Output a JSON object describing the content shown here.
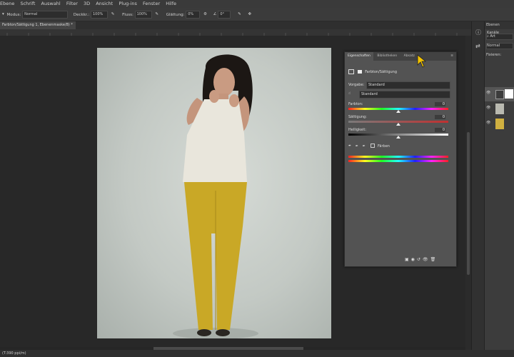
{
  "menubar": {
    "items": [
      "Ebene",
      "Schrift",
      "Auswahl",
      "Filter",
      "3D",
      "Ansicht",
      "Plug-ins",
      "Fenster",
      "Hilfe"
    ]
  },
  "options": {
    "mode_label": "Modus:",
    "mode_value": "Normal",
    "opacity_label": "Deckkr.:",
    "opacity_value": "100%",
    "flow_label": "Fluss:",
    "flow_value": "100%",
    "smoothing_label": "Glättung:",
    "smoothing_value": "0%",
    "angle_value": "0°"
  },
  "document": {
    "tab_title": "Farbton/Sättigung 1, Ebenenmaske/8) *"
  },
  "properties": {
    "tabs": [
      "Eigenschaften",
      "Bibliotheken",
      "Absatz"
    ],
    "title": "Farbton/Sättigung",
    "preset_label": "Vorgabe:",
    "preset_value": "Standard",
    "channel_value": "Standard",
    "hue_label": "Farbton:",
    "hue_value": "0",
    "saturation_label": "Sättigung:",
    "saturation_value": "0",
    "lightness_label": "Helligkeit:",
    "lightness_value": "0",
    "colorize_label": "Färben"
  },
  "layers": {
    "tabs": [
      "Ebenen",
      "Kanäle"
    ],
    "search_placeholder": "Art",
    "blend_mode": "Normal",
    "lock_label": "Fixieren:"
  },
  "status": {
    "zoom": "(T:390 ppi/m)"
  },
  "colors": {
    "accent_cursor": "#f5c400",
    "panel": "#535353",
    "app_bg": "#282828"
  },
  "sliders": {
    "hue": 0.5,
    "saturation": 0.5,
    "lightness": 0.5
  }
}
